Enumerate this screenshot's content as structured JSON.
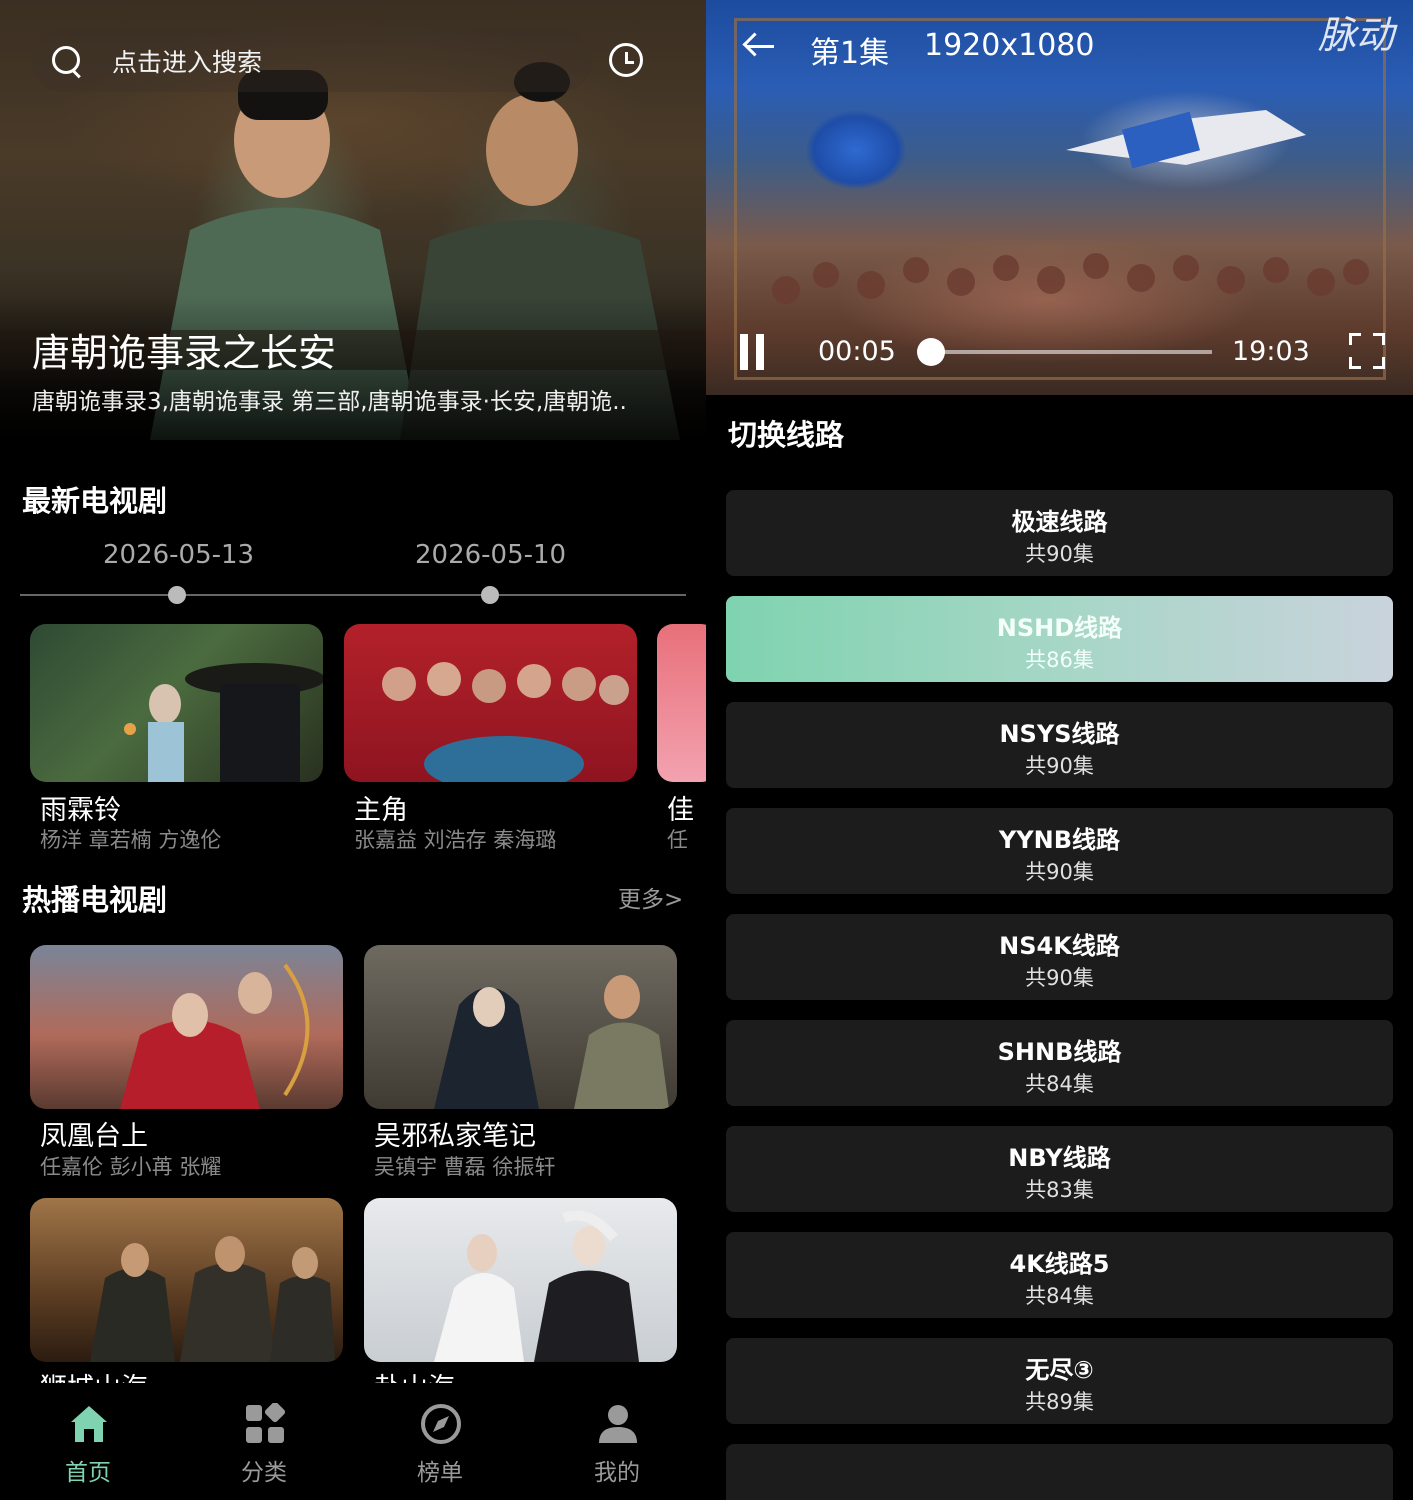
{
  "home": {
    "search_placeholder": "点击进入搜索",
    "hero": {
      "title": "唐朝诡事录之长安",
      "subtitle": "唐朝诡事录3,唐朝诡事录 第三部,唐朝诡事录·长安,唐朝诡.."
    },
    "latest": {
      "title": "最新电视剧",
      "dates": [
        "2026-05-13",
        "2026-05-10"
      ],
      "items": [
        {
          "title": "雨霖铃",
          "cast": "杨洋 章若楠 方逸伦"
        },
        {
          "title": "主角",
          "cast": "张嘉益  刘浩存  秦海璐"
        },
        {
          "title": "佳",
          "cast": "任"
        }
      ]
    },
    "hot": {
      "title": "热播电视剧",
      "more": "更多>",
      "items": [
        {
          "title": "凤凰台上",
          "cast": "任嘉伦 彭小苒 张耀"
        },
        {
          "title": "吴邪私家笔记",
          "cast": "吴镇宇 曹磊 徐振轩"
        },
        {
          "title": "狮城山海",
          "cast": ""
        },
        {
          "title": "赴山海",
          "cast": ""
        }
      ]
    },
    "nav": [
      {
        "label": "首页",
        "icon": "home-icon",
        "active": true
      },
      {
        "label": "分类",
        "icon": "category-icon",
        "active": false
      },
      {
        "label": "榜单",
        "icon": "compass-icon",
        "active": false
      },
      {
        "label": "我的",
        "icon": "user-icon",
        "active": false
      }
    ],
    "colors": {
      "accent": "#7fd3b0",
      "background": "#000000"
    }
  },
  "player": {
    "watermark": "脉动",
    "episode": "第1集",
    "resolution": "1920x1080",
    "time_current": "00:05",
    "time_total": "19:03",
    "progress_fraction": 0.004,
    "routes_title": "切换线路",
    "routes": [
      {
        "name": "极速线路",
        "count": "共90集",
        "active": false
      },
      {
        "name": "NSHD线路",
        "count": "共86集",
        "active": true
      },
      {
        "name": "NSYS线路",
        "count": "共90集",
        "active": false
      },
      {
        "name": "YYNB线路",
        "count": "共90集",
        "active": false
      },
      {
        "name": "NS4K线路",
        "count": "共90集",
        "active": false
      },
      {
        "name": "SHNB线路",
        "count": "共84集",
        "active": false
      },
      {
        "name": "NBY线路",
        "count": "共83集",
        "active": false
      },
      {
        "name": "4K线路5",
        "count": "共84集",
        "active": false
      },
      {
        "name": "无尽③",
        "count": "共89集",
        "active": false
      }
    ]
  }
}
